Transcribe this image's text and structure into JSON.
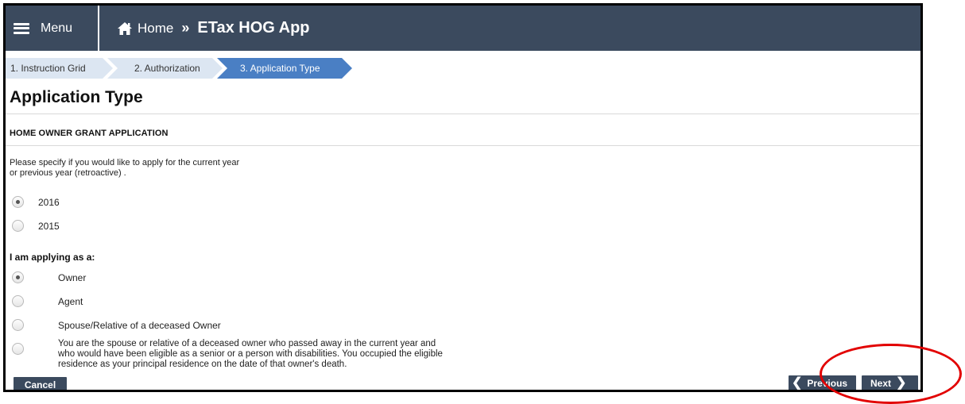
{
  "header": {
    "menu_label": "Menu",
    "menu_icon": "hamburger-icon",
    "home_icon": "home-icon",
    "breadcrumb_home": "Home",
    "breadcrumb_separator": "»",
    "breadcrumb_current": "ETax HOG App"
  },
  "steps": [
    {
      "label": "1. Instruction Grid",
      "state": "inactive"
    },
    {
      "label": "2. Authorization",
      "state": "inactive"
    },
    {
      "label": "3. Application Type",
      "state": "active"
    }
  ],
  "page": {
    "title": "Application Type",
    "section_heading": "HOME OWNER GRANT APPLICATION",
    "intro_line1": "Please specify if you would like to apply for the current year",
    "intro_line2": "or previous year (retroactive) ."
  },
  "year_options": [
    {
      "label": "2016",
      "checked": true
    },
    {
      "label": "2015",
      "checked": false
    }
  ],
  "applying_as": {
    "label": "I am applying as a:",
    "options": [
      {
        "label": "Owner",
        "checked": true
      },
      {
        "label": "Agent",
        "checked": false
      },
      {
        "label": "Spouse/Relative of a deceased Owner",
        "checked": false
      },
      {
        "label_line1": "You are the spouse or relative of a deceased owner who passed away in the current year and",
        "label_line2": "who would have been eligible as a senior or a person with disabilities. You occupied the eligible",
        "label_line3": "residence as your principal residence on the date of that owner's death.",
        "checked": false
      }
    ]
  },
  "footer": {
    "cancel_label": "Cancel",
    "previous_label": "Previous",
    "next_label": "Next",
    "previous_icon": "chevron-left-icon",
    "next_icon": "chevron-right-icon"
  },
  "colors": {
    "header_bg": "#3b4a5e",
    "step_active": "#4a7fc4",
    "step_inactive": "#dce6f2",
    "annotation": "#e20000"
  }
}
